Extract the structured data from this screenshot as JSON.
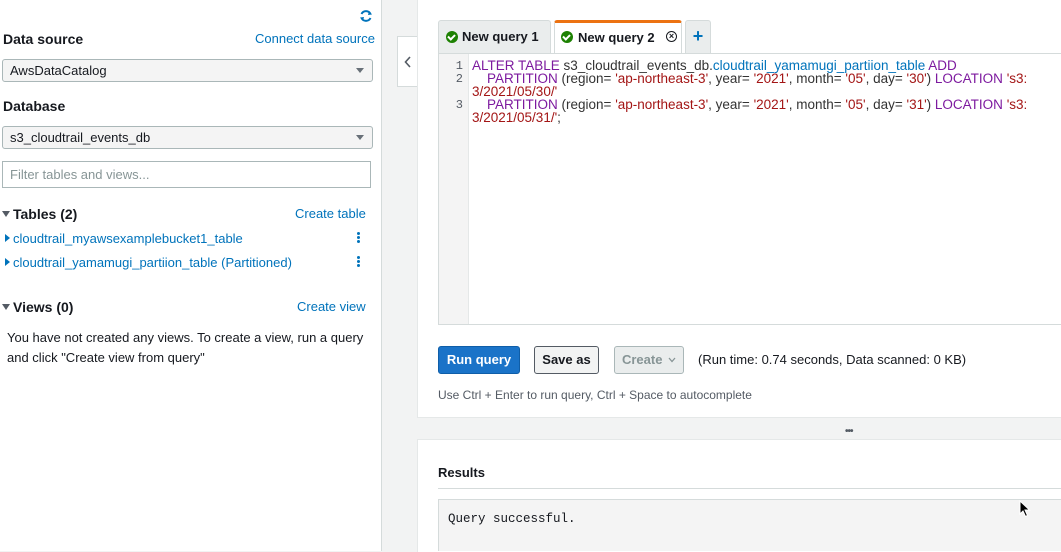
{
  "sidebar": {
    "data_source_label": "Data source",
    "connect_link": "Connect data source",
    "data_source_value": "AwsDataCatalog",
    "database_label": "Database",
    "database_value": "s3_cloudtrail_events_db",
    "filter_placeholder": "Filter tables and views...",
    "tables_header": "Tables (2)",
    "create_table": "Create table",
    "tables": [
      {
        "name": "cloudtrail_myawsexamplebucket1_table"
      },
      {
        "name": "cloudtrail_yamamugi_partiion_table (Partitioned)"
      }
    ],
    "views_header": "Views (0)",
    "create_view": "Create view",
    "views_message": "You have not created any views. To create a view, run a query and click \"Create view from query\""
  },
  "tabs": [
    {
      "label": "New query 1"
    },
    {
      "label": "New query 2"
    }
  ],
  "editor": {
    "line_numbers": [
      "1",
      "2",
      "3"
    ],
    "line1": {
      "kw1": "ALTER TABLE",
      "db": " s3_cloudtrail_events_db.",
      "tbl": "cloudtrail_yamamugi_partiion_table",
      "kw2": " ADD"
    },
    "line2": {
      "kw": "    PARTITION",
      "a": " (region= ",
      "region": "'ap-northeast-3'",
      "b": ", year= ",
      "year": "'2021'",
      "c": ", month= ",
      "month": "'05'",
      "d": ", day= ",
      "day": "'30'",
      "e": ") ",
      "loc": "LOCATION",
      "path": " 's3:"
    },
    "line2_wrap": "3/2021/05/30/'",
    "line3": {
      "kw": "    PARTITION",
      "a": " (region= ",
      "region": "'ap-northeast-3'",
      "b": ", year= ",
      "year": "'2021'",
      "c": ", month= ",
      "month": "'05'",
      "d": ", day= ",
      "day": "'31'",
      "e": ") ",
      "loc": "LOCATION",
      "path": " 's3:"
    },
    "line3_wrap": "3/2021/05/31/'",
    "line3_end": ";"
  },
  "toolbar": {
    "run": "Run query",
    "save": "Save as",
    "create": "Create",
    "runtime": "(Run time: 0.74 seconds, Data scanned: 0 KB)",
    "hint": "Use Ctrl + Enter to run query, Ctrl + Space to autocomplete"
  },
  "results": {
    "title": "Results",
    "message": "Query successful."
  },
  "colors": {
    "accent": "#0073bb",
    "tab_active": "#ec7211",
    "success": "#1d8102",
    "primary_button": "#1a73c8"
  }
}
